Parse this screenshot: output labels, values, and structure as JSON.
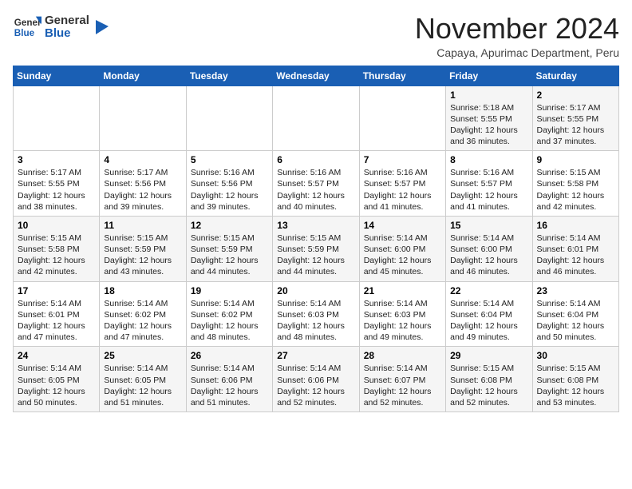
{
  "header": {
    "logo_line1": "General",
    "logo_line2": "Blue",
    "month": "November 2024",
    "location": "Capaya, Apurimac Department, Peru"
  },
  "weekdays": [
    "Sunday",
    "Monday",
    "Tuesday",
    "Wednesday",
    "Thursday",
    "Friday",
    "Saturday"
  ],
  "weeks": [
    [
      {
        "day": "",
        "info": ""
      },
      {
        "day": "",
        "info": ""
      },
      {
        "day": "",
        "info": ""
      },
      {
        "day": "",
        "info": ""
      },
      {
        "day": "",
        "info": ""
      },
      {
        "day": "1",
        "info": "Sunrise: 5:18 AM\nSunset: 5:55 PM\nDaylight: 12 hours\nand 36 minutes."
      },
      {
        "day": "2",
        "info": "Sunrise: 5:17 AM\nSunset: 5:55 PM\nDaylight: 12 hours\nand 37 minutes."
      }
    ],
    [
      {
        "day": "3",
        "info": "Sunrise: 5:17 AM\nSunset: 5:55 PM\nDaylight: 12 hours\nand 38 minutes."
      },
      {
        "day": "4",
        "info": "Sunrise: 5:17 AM\nSunset: 5:56 PM\nDaylight: 12 hours\nand 39 minutes."
      },
      {
        "day": "5",
        "info": "Sunrise: 5:16 AM\nSunset: 5:56 PM\nDaylight: 12 hours\nand 39 minutes."
      },
      {
        "day": "6",
        "info": "Sunrise: 5:16 AM\nSunset: 5:57 PM\nDaylight: 12 hours\nand 40 minutes."
      },
      {
        "day": "7",
        "info": "Sunrise: 5:16 AM\nSunset: 5:57 PM\nDaylight: 12 hours\nand 41 minutes."
      },
      {
        "day": "8",
        "info": "Sunrise: 5:16 AM\nSunset: 5:57 PM\nDaylight: 12 hours\nand 41 minutes."
      },
      {
        "day": "9",
        "info": "Sunrise: 5:15 AM\nSunset: 5:58 PM\nDaylight: 12 hours\nand 42 minutes."
      }
    ],
    [
      {
        "day": "10",
        "info": "Sunrise: 5:15 AM\nSunset: 5:58 PM\nDaylight: 12 hours\nand 42 minutes."
      },
      {
        "day": "11",
        "info": "Sunrise: 5:15 AM\nSunset: 5:59 PM\nDaylight: 12 hours\nand 43 minutes."
      },
      {
        "day": "12",
        "info": "Sunrise: 5:15 AM\nSunset: 5:59 PM\nDaylight: 12 hours\nand 44 minutes."
      },
      {
        "day": "13",
        "info": "Sunrise: 5:15 AM\nSunset: 5:59 PM\nDaylight: 12 hours\nand 44 minutes."
      },
      {
        "day": "14",
        "info": "Sunrise: 5:14 AM\nSunset: 6:00 PM\nDaylight: 12 hours\nand 45 minutes."
      },
      {
        "day": "15",
        "info": "Sunrise: 5:14 AM\nSunset: 6:00 PM\nDaylight: 12 hours\nand 46 minutes."
      },
      {
        "day": "16",
        "info": "Sunrise: 5:14 AM\nSunset: 6:01 PM\nDaylight: 12 hours\nand 46 minutes."
      }
    ],
    [
      {
        "day": "17",
        "info": "Sunrise: 5:14 AM\nSunset: 6:01 PM\nDaylight: 12 hours\nand 47 minutes."
      },
      {
        "day": "18",
        "info": "Sunrise: 5:14 AM\nSunset: 6:02 PM\nDaylight: 12 hours\nand 47 minutes."
      },
      {
        "day": "19",
        "info": "Sunrise: 5:14 AM\nSunset: 6:02 PM\nDaylight: 12 hours\nand 48 minutes."
      },
      {
        "day": "20",
        "info": "Sunrise: 5:14 AM\nSunset: 6:03 PM\nDaylight: 12 hours\nand 48 minutes."
      },
      {
        "day": "21",
        "info": "Sunrise: 5:14 AM\nSunset: 6:03 PM\nDaylight: 12 hours\nand 49 minutes."
      },
      {
        "day": "22",
        "info": "Sunrise: 5:14 AM\nSunset: 6:04 PM\nDaylight: 12 hours\nand 49 minutes."
      },
      {
        "day": "23",
        "info": "Sunrise: 5:14 AM\nSunset: 6:04 PM\nDaylight: 12 hours\nand 50 minutes."
      }
    ],
    [
      {
        "day": "24",
        "info": "Sunrise: 5:14 AM\nSunset: 6:05 PM\nDaylight: 12 hours\nand 50 minutes."
      },
      {
        "day": "25",
        "info": "Sunrise: 5:14 AM\nSunset: 6:05 PM\nDaylight: 12 hours\nand 51 minutes."
      },
      {
        "day": "26",
        "info": "Sunrise: 5:14 AM\nSunset: 6:06 PM\nDaylight: 12 hours\nand 51 minutes."
      },
      {
        "day": "27",
        "info": "Sunrise: 5:14 AM\nSunset: 6:06 PM\nDaylight: 12 hours\nand 52 minutes."
      },
      {
        "day": "28",
        "info": "Sunrise: 5:14 AM\nSunset: 6:07 PM\nDaylight: 12 hours\nand 52 minutes."
      },
      {
        "day": "29",
        "info": "Sunrise: 5:15 AM\nSunset: 6:08 PM\nDaylight: 12 hours\nand 52 minutes."
      },
      {
        "day": "30",
        "info": "Sunrise: 5:15 AM\nSunset: 6:08 PM\nDaylight: 12 hours\nand 53 minutes."
      }
    ]
  ]
}
